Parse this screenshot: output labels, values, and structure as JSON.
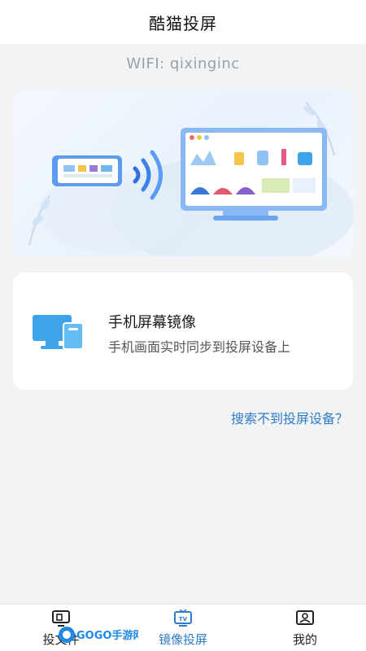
{
  "header": {
    "title": "酷猫投屏"
  },
  "wifi": {
    "label": "WIFI: qixinginc"
  },
  "mirror_card": {
    "title": "手机屏幕镜像",
    "description": "手机画面实时同步到投屏设备上"
  },
  "help_link": {
    "text": "搜索不到投屏设备？"
  },
  "tabs": [
    {
      "label": "投文件",
      "icon": "file-cast-icon",
      "active": false
    },
    {
      "label": "镜像投屏",
      "icon": "tv-mirror-icon",
      "active": true
    },
    {
      "label": "我的",
      "icon": "profile-icon",
      "active": false
    }
  ],
  "watermark": {
    "text": "GOGO手游网"
  },
  "colors": {
    "accent": "#2f7cc7",
    "icon_blue": "#3fa3ea",
    "background": "#f2f3f5"
  }
}
